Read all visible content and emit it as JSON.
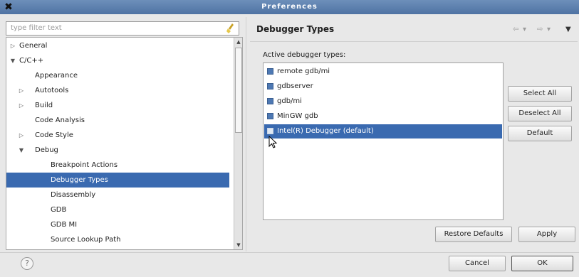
{
  "window": {
    "title": "Preferences",
    "close_symbol": "✖"
  },
  "filter": {
    "placeholder": "type filter text"
  },
  "tree": {
    "items": [
      {
        "label": "General",
        "arrow": "▷",
        "level": 0
      },
      {
        "label": "C/C++",
        "arrow": "▼",
        "level": 0
      },
      {
        "label": "Appearance",
        "arrow": "",
        "level": 1
      },
      {
        "label": "Autotools",
        "arrow": "▷",
        "level": 1
      },
      {
        "label": "Build",
        "arrow": "▷",
        "level": 1
      },
      {
        "label": "Code Analysis",
        "arrow": "",
        "level": 1
      },
      {
        "label": "Code Style",
        "arrow": "▷",
        "level": 1
      },
      {
        "label": "Debug",
        "arrow": "▼",
        "level": 1
      },
      {
        "label": "Breakpoint Actions",
        "arrow": "",
        "level": 2
      },
      {
        "label": "Debugger Types",
        "arrow": "",
        "level": 2,
        "selected": true
      },
      {
        "label": "Disassembly",
        "arrow": "",
        "level": 2
      },
      {
        "label": "GDB",
        "arrow": "",
        "level": 2
      },
      {
        "label": "GDB MI",
        "arrow": "",
        "level": 2
      },
      {
        "label": "Source Lookup Path",
        "arrow": "",
        "level": 2
      }
    ]
  },
  "page": {
    "title": "Debugger Types",
    "active_label": "Active debugger types:",
    "debuggers": [
      {
        "label": "remote gdb/mi",
        "checked": true
      },
      {
        "label": "gdbserver",
        "checked": true
      },
      {
        "label": "gdb/mi",
        "checked": true
      },
      {
        "label": "MinGW gdb",
        "checked": true
      },
      {
        "label": "Intel(R) Debugger (default)",
        "checked": false,
        "selected": true
      }
    ],
    "select_all": "Select All",
    "deselect_all": "Deselect All",
    "default_btn": "Default",
    "restore_defaults": "Restore Defaults",
    "apply": "Apply"
  },
  "footer": {
    "cancel": "Cancel",
    "ok": "OK",
    "help_symbol": "?"
  },
  "colors": {
    "selection": "#3a6ab0",
    "titlebar": "#5a7cab"
  }
}
